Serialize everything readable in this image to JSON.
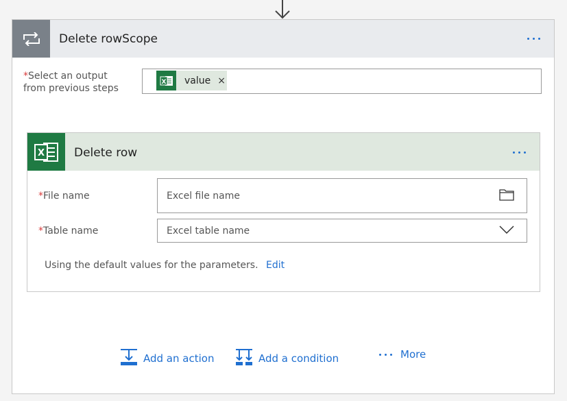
{
  "scope": {
    "title": "Delete rowScope",
    "select_output_label_line1": "Select an output",
    "select_output_label_line2": "from previous steps",
    "required_mark": "*",
    "token": {
      "label": "value",
      "close": "×"
    }
  },
  "action": {
    "title": "Delete row",
    "file_name_label": "File name",
    "file_name_placeholder": "Excel file name",
    "table_name_label": "Table name",
    "table_name_placeholder": "Excel table name",
    "hint_text": "Using the default values for the parameters.",
    "edit_link": "Edit"
  },
  "footer": {
    "add_action": "Add an action",
    "add_condition": "Add a condition",
    "more": "More"
  },
  "colors": {
    "accent": "#1f6fd0",
    "excel_green": "#1f7a43",
    "scope_icon_bg": "#7a8189",
    "required": "#d83b3b"
  }
}
